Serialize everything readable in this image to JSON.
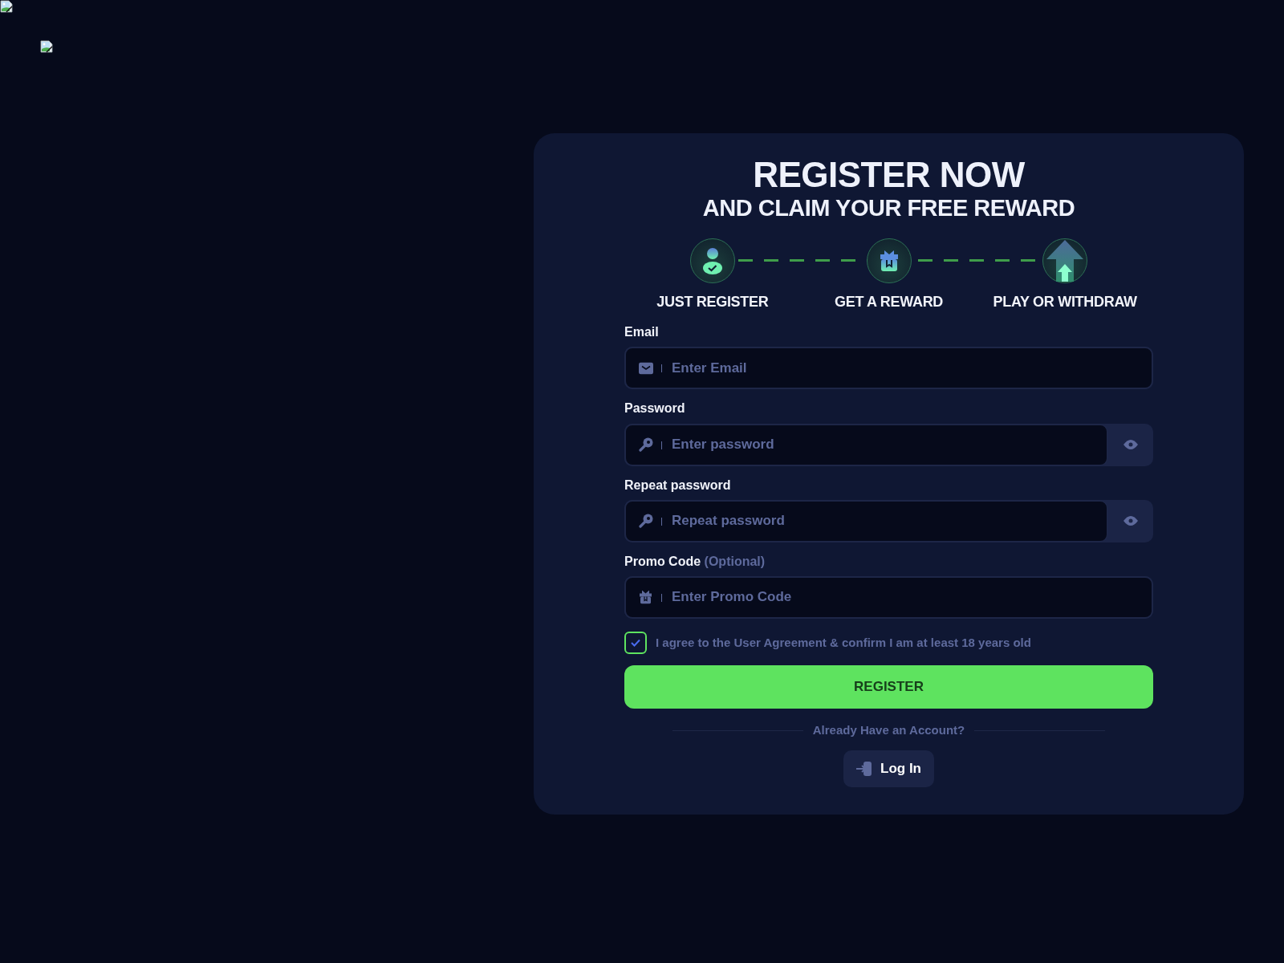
{
  "title": "REGISTER NOW",
  "subtitle": "AND CLAIM YOUR FREE REWARD",
  "steps": [
    {
      "label": "JUST REGISTER"
    },
    {
      "label": "GET A REWARD"
    },
    {
      "label": "PLAY OR WITHDRAW"
    }
  ],
  "fields": [
    {
      "label": "Email",
      "placeholder": "Enter Email",
      "kind": "email"
    },
    {
      "label": "Password",
      "placeholder": "Enter password",
      "kind": "password"
    },
    {
      "label": "Repeat password",
      "placeholder": "Repeat password",
      "kind": "password"
    },
    {
      "label": "Promo Code",
      "note": "(Optional)",
      "placeholder": "Enter Promo Code",
      "kind": "promo"
    }
  ],
  "agreement": {
    "text": "I agree to the User Agreement & confirm I am at least 18 years old",
    "checked": true
  },
  "register_button": "REGISTER",
  "divider_text": "Already Have an Account?",
  "login_button": "Log In"
}
